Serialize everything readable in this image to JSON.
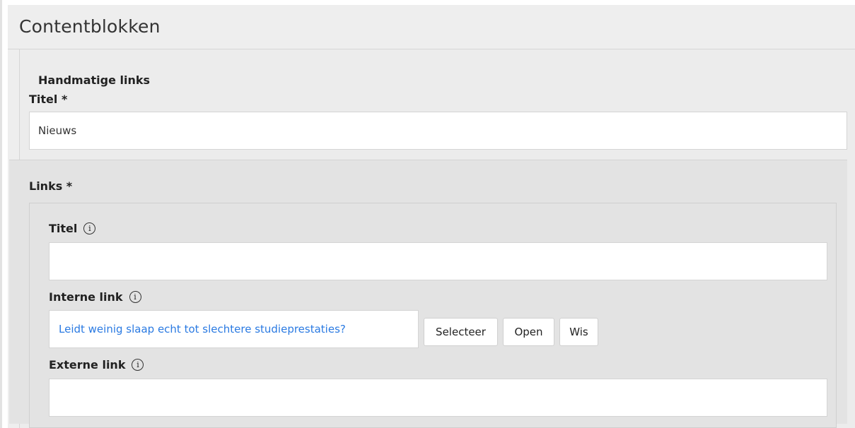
{
  "panel": {
    "title": "Contentblokken"
  },
  "block": {
    "heading": "Handmatige links",
    "title_label": "Titel *",
    "title_value": "Nieuws",
    "links_label": "Links *"
  },
  "link_item": {
    "titel_label": "Titel",
    "titel_value": "",
    "interne_label": "Interne link",
    "interne_value": "Leidt weinig slaap echt tot slechtere studieprestaties?",
    "externe_label": "Externe link",
    "externe_value": "",
    "info_glyph": "i",
    "buttons": {
      "select": "Selecteer",
      "open": "Open",
      "clear": "Wis"
    }
  },
  "colors": {
    "panel_bg": "#eeeeee",
    "link_color": "#2a7ae2"
  }
}
